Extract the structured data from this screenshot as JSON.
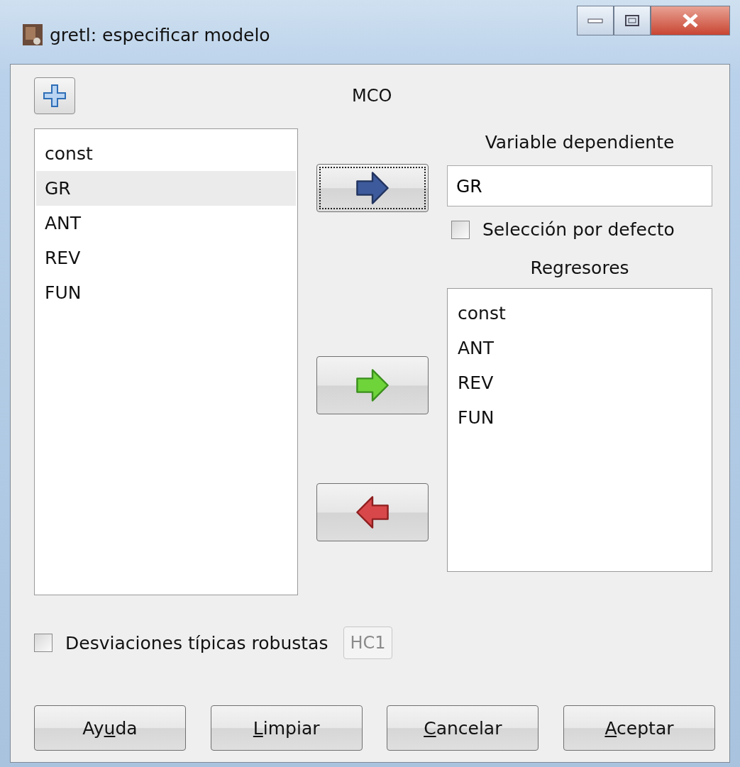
{
  "window": {
    "title": "gretl: especificar modelo"
  },
  "estimator": "MCO",
  "variables": [
    {
      "label": "const",
      "selected": false
    },
    {
      "label": "GR",
      "selected": true
    },
    {
      "label": "ANT",
      "selected": false
    },
    {
      "label": "REV",
      "selected": false
    },
    {
      "label": "FUN",
      "selected": false
    }
  ],
  "move_buttons": [
    {
      "kind": "dependent",
      "focused": true
    },
    {
      "kind": "add",
      "focused": false
    },
    {
      "kind": "remove",
      "focused": false
    }
  ],
  "dependent": {
    "heading": "Variable dependiente",
    "value": "GR"
  },
  "default_selection": {
    "label": "Selección por defecto",
    "checked": false
  },
  "regressors": {
    "heading": "Regresores",
    "items": [
      {
        "label": "const",
        "selected": false
      },
      {
        "label": "ANT",
        "selected": false
      },
      {
        "label": "REV",
        "selected": false
      },
      {
        "label": "FUN",
        "selected": false
      }
    ]
  },
  "robust": {
    "label": "Desviaciones típicas robustas",
    "checked": false,
    "variant": "HC1",
    "disabled": true
  },
  "buttons": [
    {
      "before": "Ay",
      "mnemonic": "u",
      "after": "da"
    },
    {
      "mnemonic": "L",
      "after": "impiar"
    },
    {
      "mnemonic": "C",
      "after": "ancelar"
    },
    {
      "mnemonic": "A",
      "after": "ceptar"
    }
  ]
}
